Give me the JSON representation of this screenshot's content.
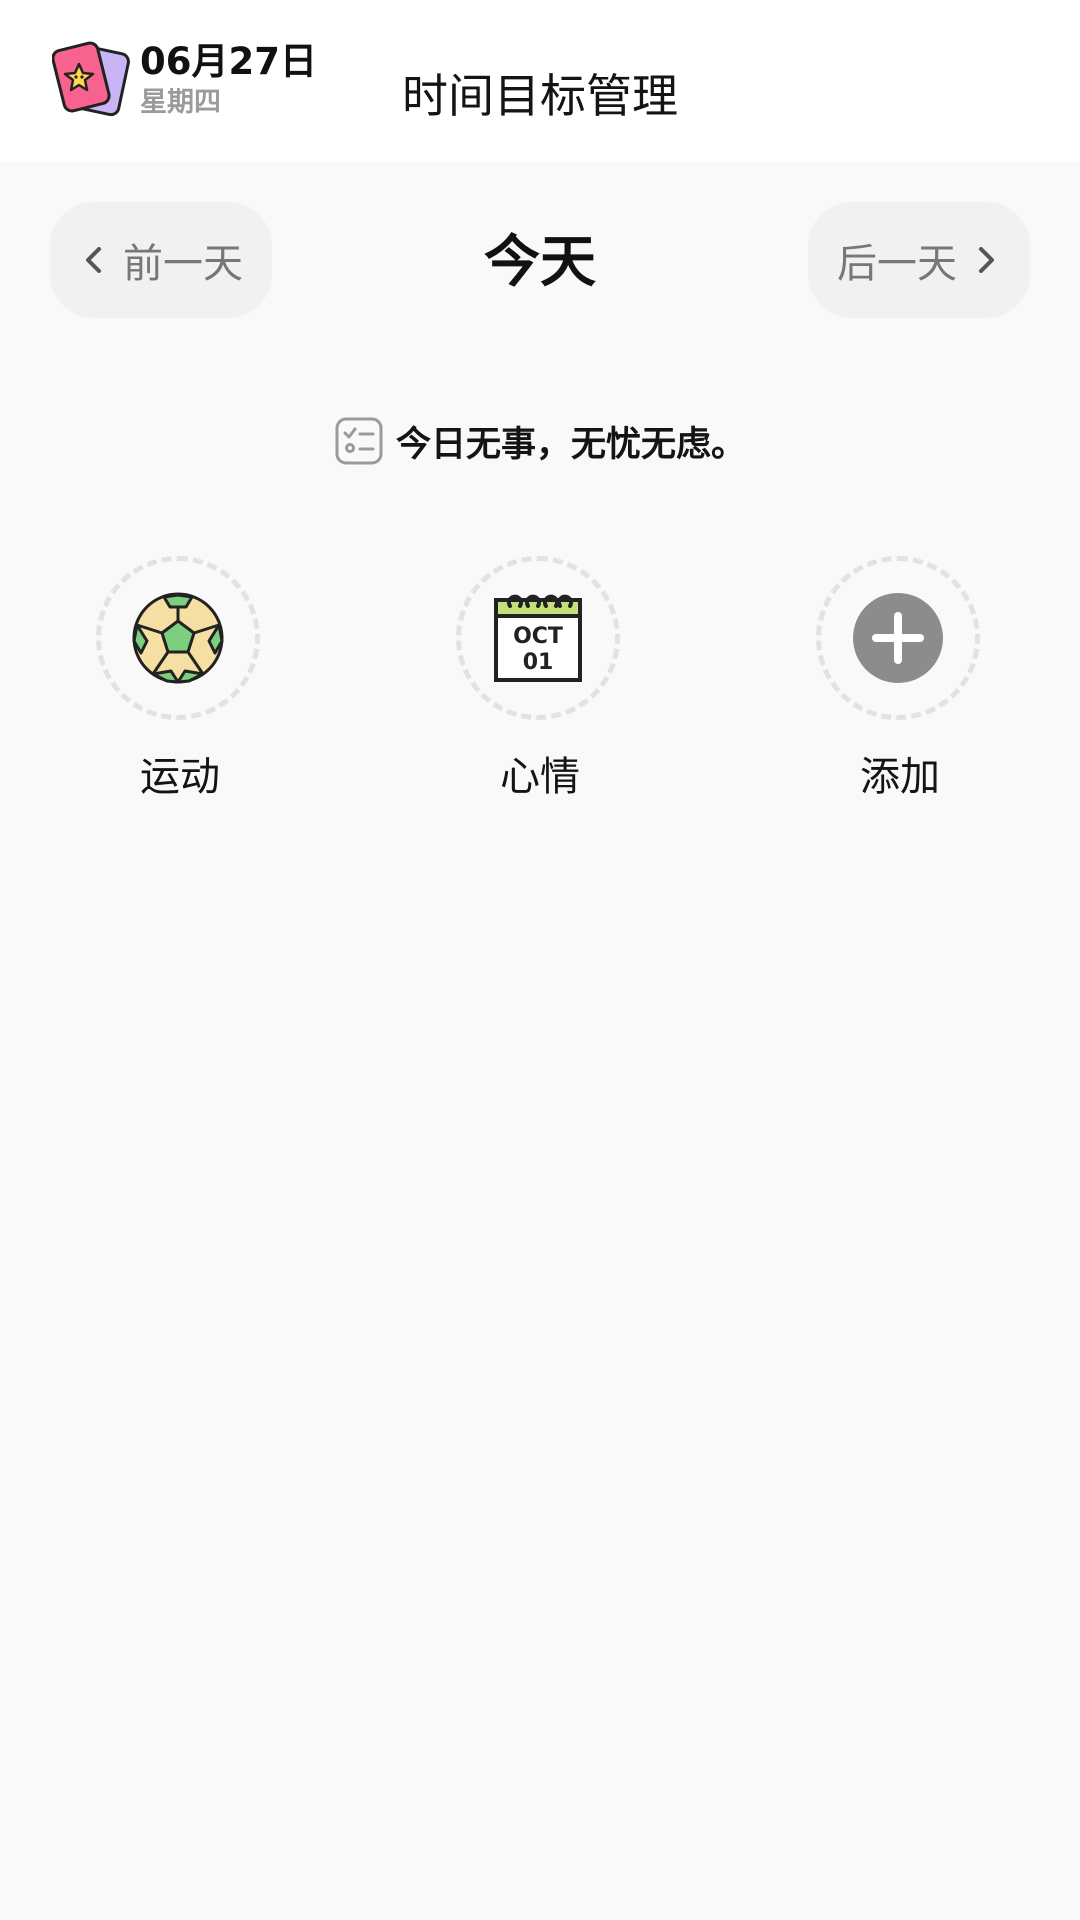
{
  "header": {
    "date": "06月27日",
    "weekday": "星期四",
    "title": "时间目标管理",
    "logo_icon": "star-card-icon"
  },
  "day_nav": {
    "prev_label": "前一天",
    "today_label": "今天",
    "next_label": "后一天"
  },
  "empty_message": {
    "icon": "checklist-icon",
    "text": "今日无事，无忧无虑。"
  },
  "categories": [
    {
      "label": "运动",
      "icon": "soccer-ball-icon"
    },
    {
      "label": "心情",
      "icon": "calendar-icon",
      "icon_text_month": "OCT",
      "icon_text_day": "01"
    },
    {
      "label": "添加",
      "icon": "add-icon"
    }
  ],
  "colors": {
    "background": "#f9f9f9",
    "header_bg": "#ffffff",
    "nav_button_bg": "#f1f1f1",
    "muted_text": "#9b9b9b",
    "add_icon": "#8c8c8c",
    "calendar_top": "#c5e07a",
    "ball_green": "#7ccf7e",
    "ball_cream": "#f6dfa3"
  }
}
